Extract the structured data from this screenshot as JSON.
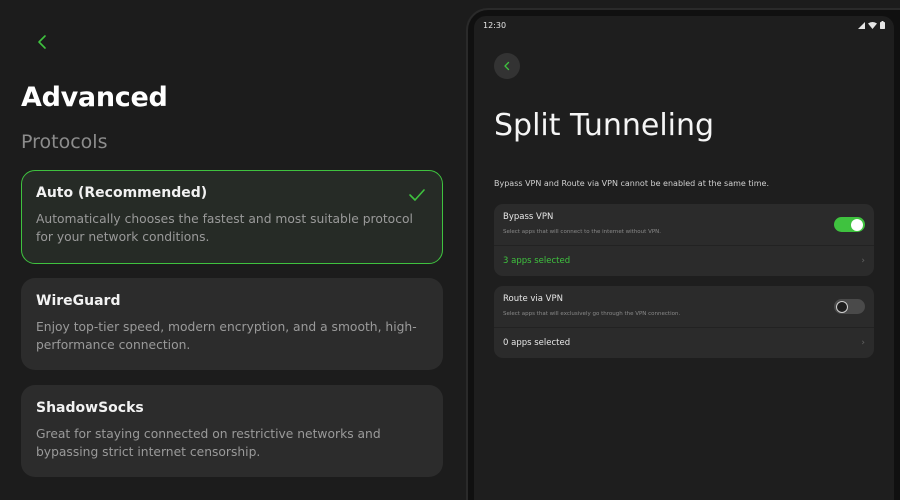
{
  "left": {
    "title": "Advanced",
    "section": "Protocols",
    "protocols": [
      {
        "name": "Auto (Recommended)",
        "description": "Automatically chooses the fastest and most suitable protocol for your network conditions.",
        "selected": true
      },
      {
        "name": "WireGuard",
        "description": "Enjoy top-tier speed, modern encryption, and a smooth, high-performance connection.",
        "selected": false
      },
      {
        "name": "ShadowSocks",
        "description": "Great for staying connected on restrictive networks and bypassing strict internet censorship.",
        "selected": false
      }
    ]
  },
  "device": {
    "status_time": "12:30",
    "title": "Split Tunneling",
    "note": "Bypass VPN and Route via VPN cannot be enabled at the same time.",
    "bypass": {
      "label": "Bypass VPN",
      "description": "Select apps that will connect to the internet without VPN.",
      "enabled": true,
      "apps": "3 apps selected"
    },
    "route": {
      "label": "Route via VPN",
      "description": "Select apps that will exclusively go through the VPN connection.",
      "enabled": false,
      "apps": "0 apps selected"
    }
  },
  "colors": {
    "accent": "#3fc23f",
    "background": "#1c1c1c",
    "card": "#2c2c2c"
  },
  "icons": [
    "chevron-left-icon",
    "checkmark-icon",
    "wifi-icon",
    "signal-icon",
    "battery-icon",
    "chevron-right-icon"
  ]
}
